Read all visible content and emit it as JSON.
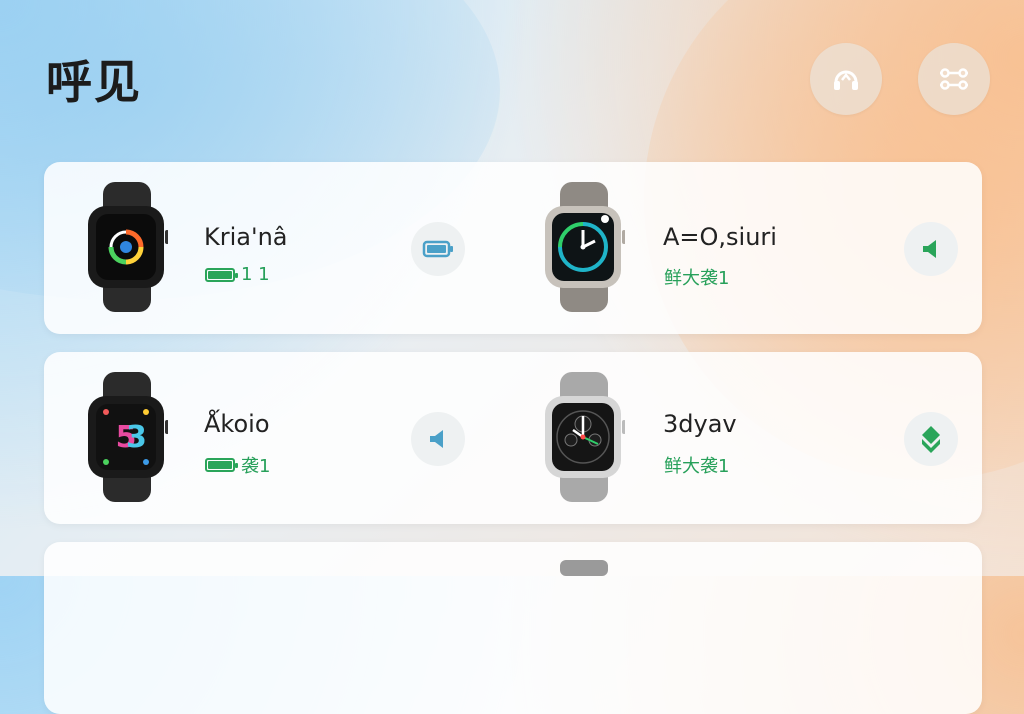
{
  "header": {
    "title": "呼见",
    "buttons": [
      {
        "icon": "headset-icon"
      },
      {
        "icon": "settings-sliders-icon"
      }
    ]
  },
  "devices": [
    {
      "name": "Kria'nâ",
      "status": "1 1",
      "status_icon": "battery-icon",
      "action_icon": "battery-action-icon",
      "watch": "black",
      "face": "activity"
    },
    {
      "name": "A=O,siuri",
      "status": "鲜大袭1",
      "status_icon": "none",
      "action_icon": "speaker-icon",
      "watch": "silver",
      "face": "clock"
    },
    {
      "name": "Ǻkoio",
      "status": "袭1",
      "status_icon": "battery-icon",
      "action_icon": "speaker-icon",
      "watch": "black",
      "face": "digital"
    },
    {
      "name": "3dyav",
      "status": "鲜大袭1",
      "status_icon": "none",
      "action_icon": "chevron-down-icon",
      "watch": "steel",
      "face": "chrono"
    }
  ],
  "colors": {
    "accent_green": "#2aa55a",
    "action_blue": "#4aa0c8",
    "card_bg": "#ffffff"
  }
}
